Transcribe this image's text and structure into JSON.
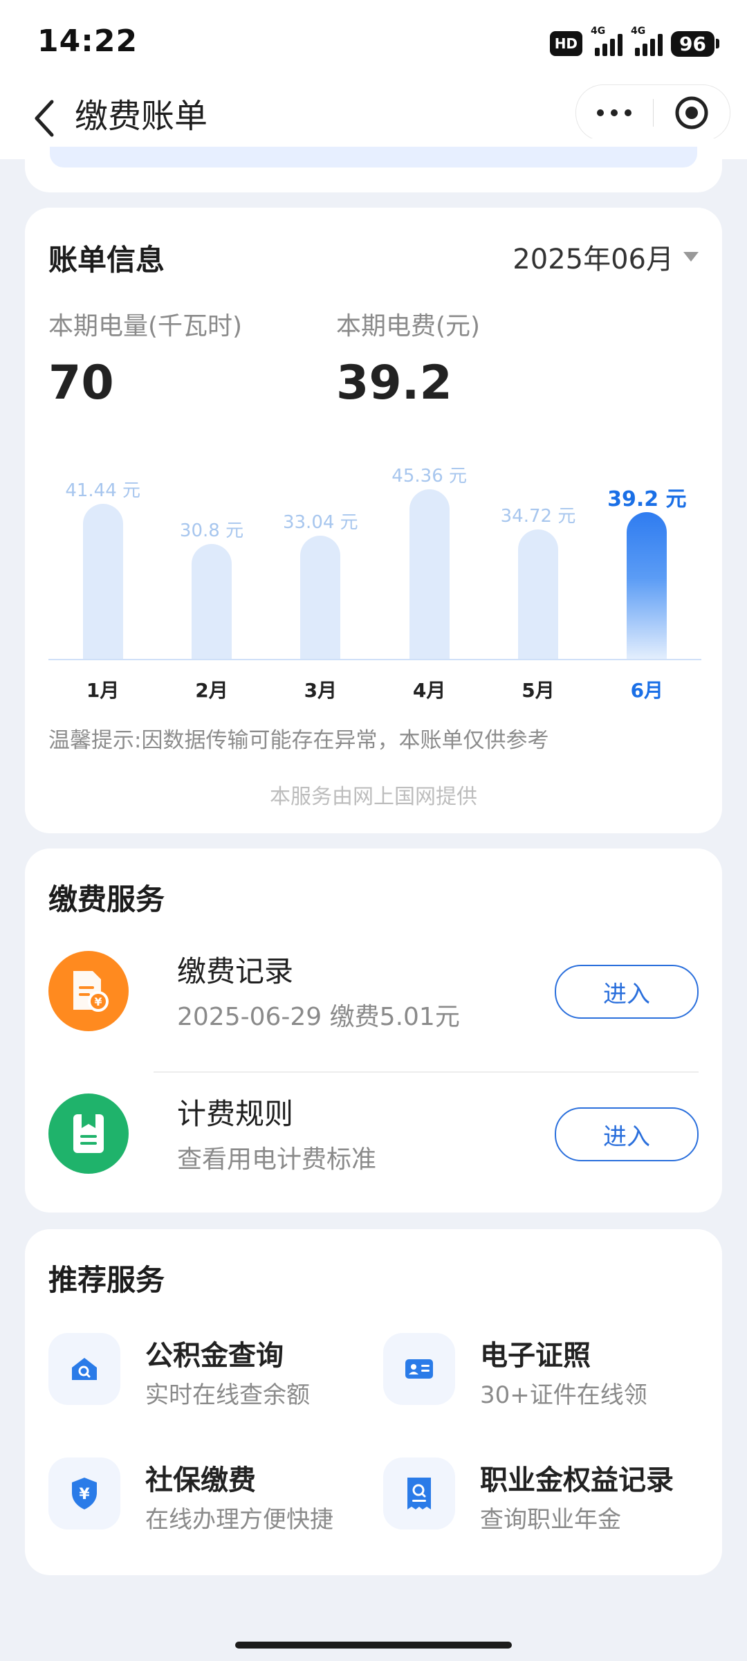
{
  "status_bar": {
    "time": "14:22",
    "hd": "HD",
    "net1": "4G",
    "net2": "4G",
    "battery": "96"
  },
  "nav": {
    "title": "缴费账单"
  },
  "bill": {
    "title": "账单信息",
    "month": "2025年06月",
    "usage_label": "本期电量(千瓦时)",
    "usage_value": "70",
    "fee_label": "本期电费(元)",
    "fee_value": "39.2",
    "tip": "温馨提示:因数据传输可能存在异常，本账单仅供参考",
    "provider": "本服务由网上国网提供"
  },
  "chart_data": {
    "type": "bar",
    "categories": [
      "1月",
      "2月",
      "3月",
      "4月",
      "5月",
      "6月"
    ],
    "values": [
      41.44,
      30.8,
      33.04,
      45.36,
      34.72,
      39.2
    ],
    "value_labels": [
      "41.44 元",
      "30.8 元",
      "33.04 元",
      "45.36 元",
      "34.72 元",
      "39.2 元"
    ],
    "highlight_index": 5,
    "ylim": [
      0,
      50
    ],
    "colors": {
      "inactive": "#deeafb",
      "active": "#2f7cf0",
      "inactive_label": "#a7c6ee"
    }
  },
  "payment_services": {
    "title": "缴费服务",
    "items": [
      {
        "name": "缴费记录",
        "desc": "2025-06-29 缴费5.01元",
        "button": "进入",
        "icon": "bill-receipt-icon",
        "color": "#ff8a1f"
      },
      {
        "name": "计费规则",
        "desc": "查看用电计费标准",
        "button": "进入",
        "icon": "rule-document-icon",
        "color": "#1fb36b"
      }
    ]
  },
  "recommended": {
    "title": "推荐服务",
    "items": [
      {
        "name": "公积金查询",
        "desc": "实时在线查余额",
        "icon": "house-search-icon"
      },
      {
        "name": "电子证照",
        "desc": "30+证件在线领",
        "icon": "id-card-icon"
      },
      {
        "name": "社保缴费",
        "desc": "在线办理方便快捷",
        "icon": "shield-yuan-icon"
      },
      {
        "name": "职业金权益记录",
        "desc": "查询职业年金",
        "icon": "receipt-search-icon"
      }
    ]
  }
}
